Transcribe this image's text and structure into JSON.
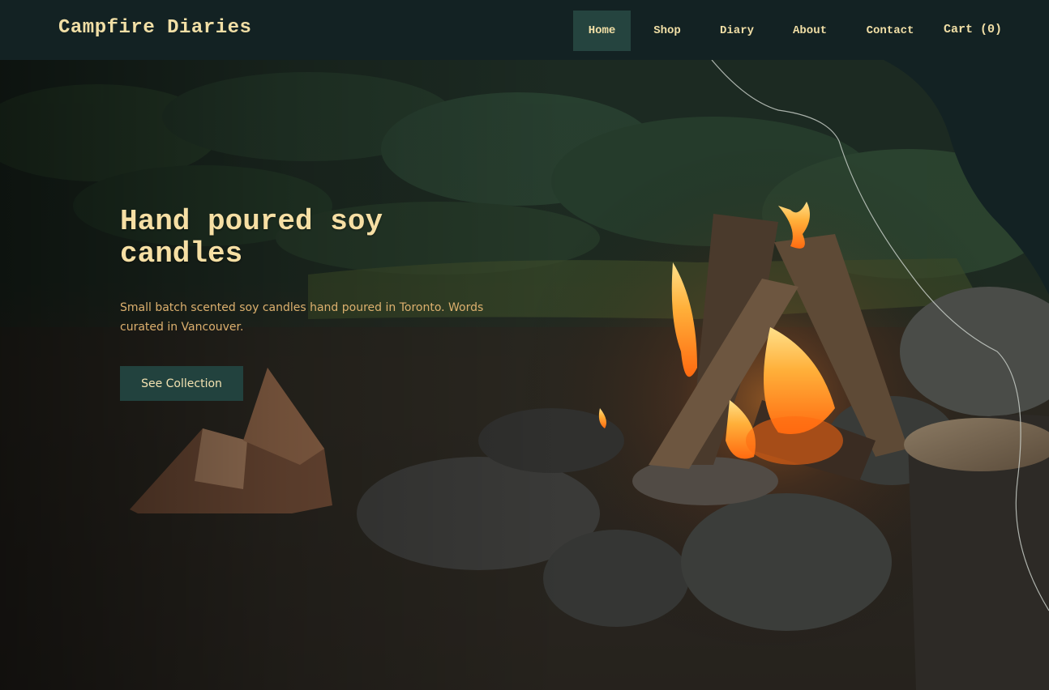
{
  "header": {
    "brand": "Campfire Diaries",
    "nav": [
      {
        "label": "Home",
        "active": true
      },
      {
        "label": "Shop",
        "active": false
      },
      {
        "label": "Diary",
        "active": false
      },
      {
        "label": "About",
        "active": false
      },
      {
        "label": "Contact",
        "active": false
      }
    ],
    "cart_label": "Cart (0)"
  },
  "hero": {
    "title": "Hand poured soy candles",
    "subtitle": "Small batch scented soy candles hand poured in Toronto. Words curated in Vancouver.",
    "cta_label": "See Collection",
    "background_icon": "campfire-photo"
  },
  "colors": {
    "header_bg": "#132223",
    "accent_text": "#f1dfa6",
    "active_nav_bg": "#25443f",
    "cta_bg": "#22423e",
    "subtitle_text": "#dcb06e"
  }
}
